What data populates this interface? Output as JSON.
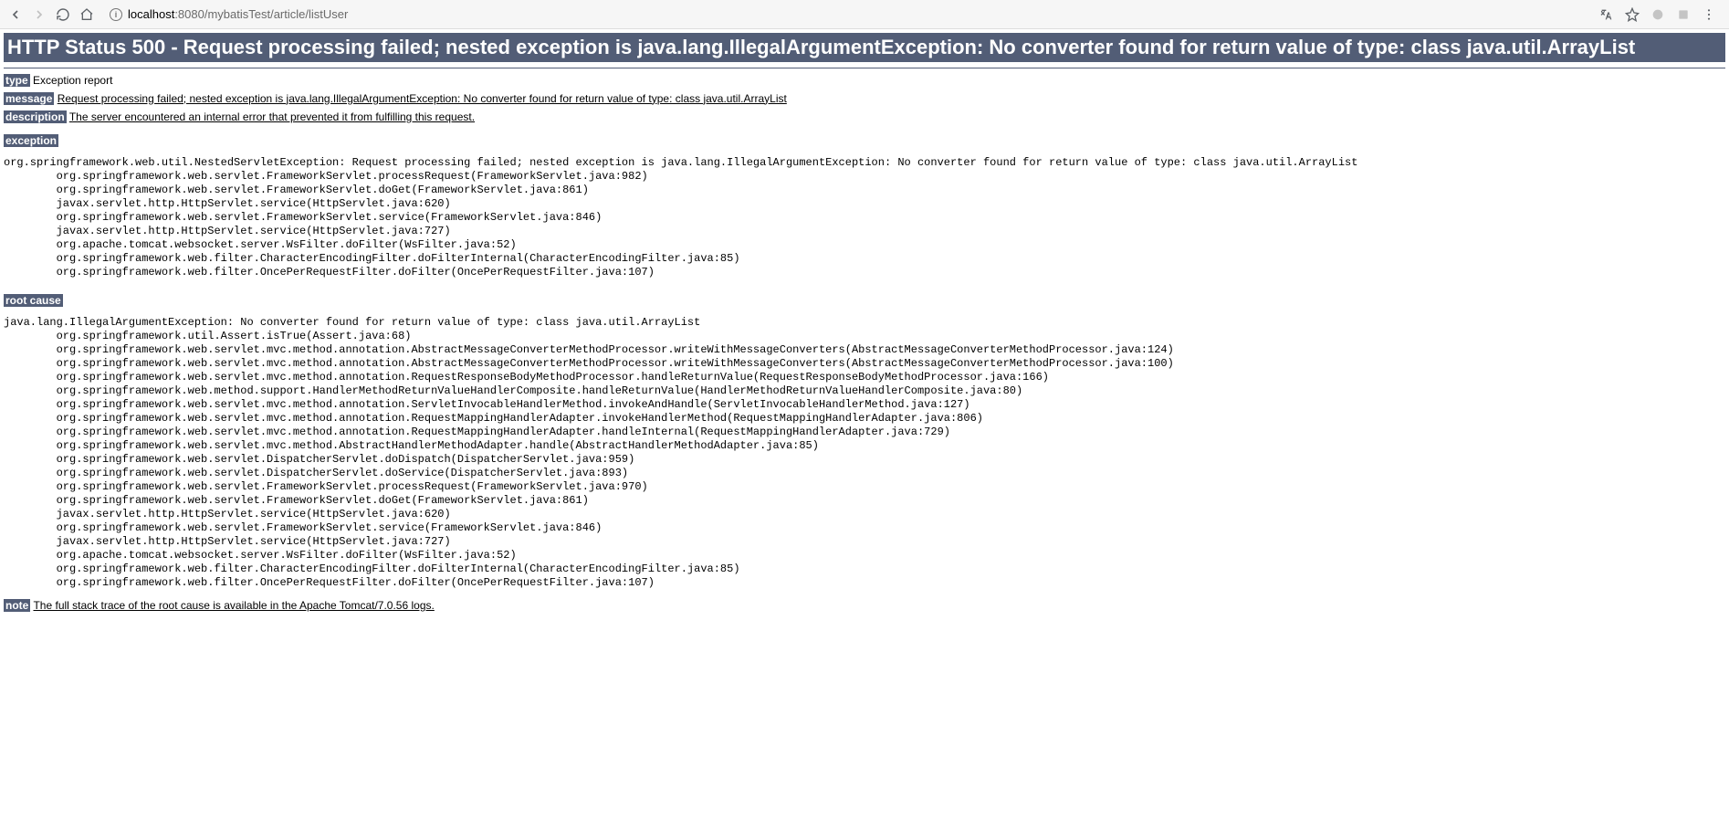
{
  "browser": {
    "host_prefix": "localhost",
    "host_suffix": ":8080/mybatisTest/article/listUser"
  },
  "header": {
    "status_title": "HTTP Status 500 - Request processing failed; nested exception is java.lang.IllegalArgumentException: No converter found for return value of type: class java.util.ArrayList"
  },
  "type": {
    "label": "type",
    "value": "Exception report"
  },
  "message": {
    "label": "message",
    "value": "Request processing failed; nested exception is java.lang.IllegalArgumentException: No converter found for return value of type: class java.util.ArrayList"
  },
  "description": {
    "label": "description",
    "value": "The server encountered an internal error that prevented it from fulfilling this request."
  },
  "exception": {
    "label": "exception",
    "trace": "org.springframework.web.util.NestedServletException: Request processing failed; nested exception is java.lang.IllegalArgumentException: No converter found for return value of type: class java.util.ArrayList\n\torg.springframework.web.servlet.FrameworkServlet.processRequest(FrameworkServlet.java:982)\n\torg.springframework.web.servlet.FrameworkServlet.doGet(FrameworkServlet.java:861)\n\tjavax.servlet.http.HttpServlet.service(HttpServlet.java:620)\n\torg.springframework.web.servlet.FrameworkServlet.service(FrameworkServlet.java:846)\n\tjavax.servlet.http.HttpServlet.service(HttpServlet.java:727)\n\torg.apache.tomcat.websocket.server.WsFilter.doFilter(WsFilter.java:52)\n\torg.springframework.web.filter.CharacterEncodingFilter.doFilterInternal(CharacterEncodingFilter.java:85)\n\torg.springframework.web.filter.OncePerRequestFilter.doFilter(OncePerRequestFilter.java:107)"
  },
  "root_cause": {
    "label": "root cause",
    "trace": "java.lang.IllegalArgumentException: No converter found for return value of type: class java.util.ArrayList\n\torg.springframework.util.Assert.isTrue(Assert.java:68)\n\torg.springframework.web.servlet.mvc.method.annotation.AbstractMessageConverterMethodProcessor.writeWithMessageConverters(AbstractMessageConverterMethodProcessor.java:124)\n\torg.springframework.web.servlet.mvc.method.annotation.AbstractMessageConverterMethodProcessor.writeWithMessageConverters(AbstractMessageConverterMethodProcessor.java:100)\n\torg.springframework.web.servlet.mvc.method.annotation.RequestResponseBodyMethodProcessor.handleReturnValue(RequestResponseBodyMethodProcessor.java:166)\n\torg.springframework.web.method.support.HandlerMethodReturnValueHandlerComposite.handleReturnValue(HandlerMethodReturnValueHandlerComposite.java:80)\n\torg.springframework.web.servlet.mvc.method.annotation.ServletInvocableHandlerMethod.invokeAndHandle(ServletInvocableHandlerMethod.java:127)\n\torg.springframework.web.servlet.mvc.method.annotation.RequestMappingHandlerAdapter.invokeHandlerMethod(RequestMappingHandlerAdapter.java:806)\n\torg.springframework.web.servlet.mvc.method.annotation.RequestMappingHandlerAdapter.handleInternal(RequestMappingHandlerAdapter.java:729)\n\torg.springframework.web.servlet.mvc.method.AbstractHandlerMethodAdapter.handle(AbstractHandlerMethodAdapter.java:85)\n\torg.springframework.web.servlet.DispatcherServlet.doDispatch(DispatcherServlet.java:959)\n\torg.springframework.web.servlet.DispatcherServlet.doService(DispatcherServlet.java:893)\n\torg.springframework.web.servlet.FrameworkServlet.processRequest(FrameworkServlet.java:970)\n\torg.springframework.web.servlet.FrameworkServlet.doGet(FrameworkServlet.java:861)\n\tjavax.servlet.http.HttpServlet.service(HttpServlet.java:620)\n\torg.springframework.web.servlet.FrameworkServlet.service(FrameworkServlet.java:846)\n\tjavax.servlet.http.HttpServlet.service(HttpServlet.java:727)\n\torg.apache.tomcat.websocket.server.WsFilter.doFilter(WsFilter.java:52)\n\torg.springframework.web.filter.CharacterEncodingFilter.doFilterInternal(CharacterEncodingFilter.java:85)\n\torg.springframework.web.filter.OncePerRequestFilter.doFilter(OncePerRequestFilter.java:107)"
  },
  "note": {
    "label": "note",
    "value": "The full stack trace of the root cause is available in the Apache Tomcat/7.0.56 logs."
  }
}
